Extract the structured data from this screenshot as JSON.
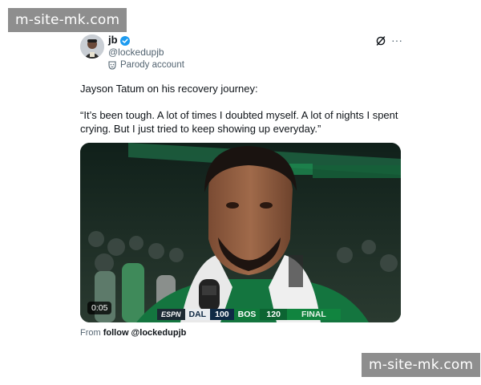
{
  "watermarks": {
    "top": "m-site-mk.com",
    "bottom": "m-site-mk.com"
  },
  "tweet": {
    "author": {
      "display_name": "jb",
      "handle": "@lockedupjb",
      "verified": true,
      "label": "Parody account"
    },
    "text_lines": [
      "Jayson Tatum on his recovery journey:",
      "“It’s been tough. A lot of times I doubted myself. A lot of nights I spent crying. But I just tried to keep showing up everyday.”"
    ],
    "media": {
      "duration": "0:05",
      "scoreboard": {
        "network": "ESPN",
        "team1": "DAL",
        "score1": "100",
        "team2": "BOS",
        "score2": "120",
        "status": "FINAL"
      }
    },
    "attribution": {
      "prefix": "From",
      "link": "follow @lockedupjb"
    }
  },
  "icons": {
    "verified": "verified-badge-icon",
    "parody": "parody-mask-icon",
    "grok": "grok-icon",
    "more": "more-options-icon"
  },
  "colors": {
    "verified_blue": "#1d9bf0",
    "text_primary": "#0f1419",
    "text_secondary": "#536471",
    "celtics_green": "#0f7a3b"
  }
}
